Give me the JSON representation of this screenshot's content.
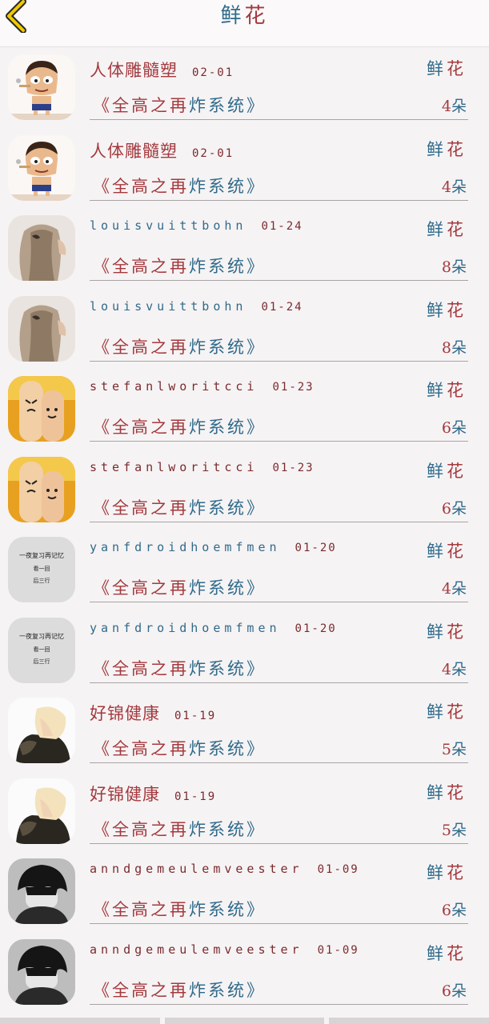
{
  "header": {
    "title_part1": "鲜",
    "title_part2": "花"
  },
  "gift_label": {
    "part1": "鲜",
    "part2": "花"
  },
  "rows": [
    {
      "name": "人体雕髓塑",
      "date": "02-01",
      "book_part1": "《全高之再",
      "book_part2": "炸系统》",
      "count": "4",
      "unit": "朵",
      "avatar": "cartoon-boy-avatar"
    },
    {
      "name": "人体雕髓塑",
      "date": "02-01",
      "book_part1": "《全高之再",
      "book_part2": "炸系统》",
      "count": "4",
      "unit": "朵",
      "avatar": "cartoon-boy-avatar"
    },
    {
      "name": "louisvuittbohn",
      "date": "01-24",
      "book_part1": "《全高之再",
      "book_part2": "炸系统》",
      "count": "8",
      "unit": "朵",
      "avatar": "woman-hair-avatar"
    },
    {
      "name": "louisvuittbohn",
      "date": "01-24",
      "book_part1": "《全高之再",
      "book_part2": "炸系统》",
      "count": "8",
      "unit": "朵",
      "avatar": "woman-hair-avatar"
    },
    {
      "name": "stefanlworitcci",
      "date": "01-23",
      "book_part1": "《全高之再",
      "book_part2": "炸系统》",
      "count": "6",
      "unit": "朵",
      "avatar": "finger-faces-avatar"
    },
    {
      "name": "stefanlworitcci",
      "date": "01-23",
      "book_part1": "《全高之再",
      "book_part2": "炸系统》",
      "count": "6",
      "unit": "朵",
      "avatar": "finger-faces-avatar"
    },
    {
      "name": "yanfdroidhoemfmen",
      "date": "01-20",
      "book_part1": "《全高之再",
      "book_part2": "炸系统》",
      "count": "4",
      "unit": "朵",
      "avatar": "text-note-avatar",
      "avatar_lines": [
        "一夜复习再记忆",
        "看一回",
        "后三行"
      ]
    },
    {
      "name": "yanfdroidhoemfmen",
      "date": "01-20",
      "book_part1": "《全高之再",
      "book_part2": "炸系统》",
      "count": "4",
      "unit": "朵",
      "avatar": "text-note-avatar",
      "avatar_lines": [
        "一夜复习再记忆",
        "看一回",
        "后三行"
      ]
    },
    {
      "name": "好锦健康",
      "date": "01-19",
      "book_part1": "《全高之再",
      "book_part2": "炸系统》",
      "count": "5",
      "unit": "朵",
      "avatar": "anime-blonde-avatar"
    },
    {
      "name": "好锦健康",
      "date": "01-19",
      "book_part1": "《全高之再",
      "book_part2": "炸系统》",
      "count": "5",
      "unit": "朵",
      "avatar": "anime-blonde-avatar"
    },
    {
      "name": "anndgemeulemveester",
      "date": "01-09",
      "book_part1": "《全高之再",
      "book_part2": "炸系统》",
      "count": "6",
      "unit": "朵",
      "avatar": "dark-hair-boy-avatar"
    },
    {
      "name": "anndgemeulemveester",
      "date": "01-09",
      "book_part1": "《全高之再",
      "book_part2": "炸系统》",
      "count": "6",
      "unit": "朵",
      "avatar": "dark-hair-boy-avatar"
    }
  ],
  "colors": {
    "accent_blue": "#2f6a8a",
    "accent_red": "#a33a3e",
    "back_yellow": "#f2c800"
  }
}
